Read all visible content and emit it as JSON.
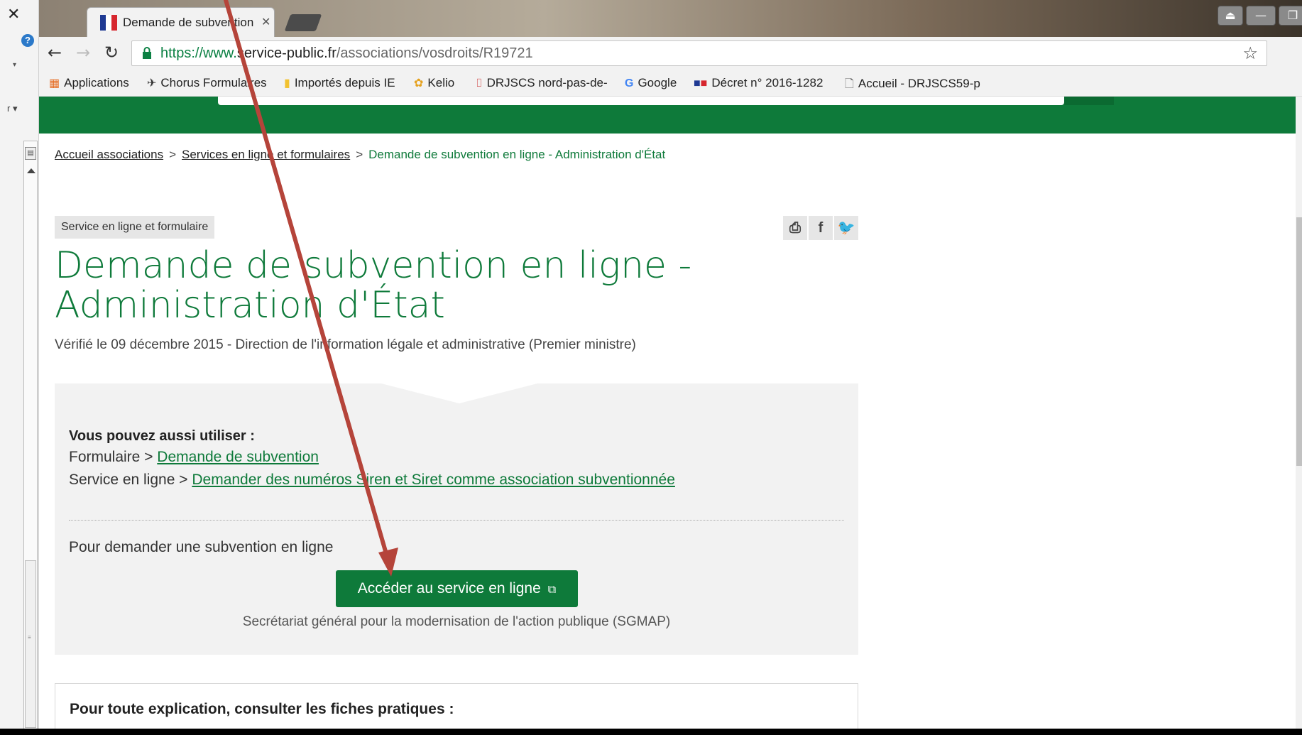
{
  "browser": {
    "tab_title": "Demande de subvention",
    "url_scheme": "https://www.",
    "url_domain": "service-public.fr",
    "url_path": "/associations/vosdroits/R19721"
  },
  "bookmarks": [
    {
      "label": "Applications",
      "icon": "apps-grid-icon"
    },
    {
      "label": "Chorus Formulaires",
      "icon": "bird-icon"
    },
    {
      "label": "Importés depuis IE",
      "icon": "folder-icon"
    },
    {
      "label": "Kelio",
      "icon": "kelio-icon"
    },
    {
      "label": "DRJSCS nord-pas-de-",
      "icon": "drjscs-icon"
    },
    {
      "label": "Google",
      "icon": "google-icon"
    },
    {
      "label": "Décret n° 2016-1282",
      "icon": "flag-icon"
    },
    {
      "label": "Accueil - DRJSCS59-p",
      "icon": "page-icon"
    }
  ],
  "breadcrumb": {
    "home": "Accueil associations",
    "sep": ">",
    "level2": "Services en ligne et formulaires",
    "current": "Demande de subvention en ligne - Administration d'État"
  },
  "tag": "Service en ligne et formulaire",
  "title": "Demande de subvention en ligne - Administration d'État",
  "verified": "Vérifié le 09 décembre 2015 - Direction de l'information légale et administrative (Premier ministre)",
  "aussi": {
    "heading": "Vous pouvez aussi utiliser :",
    "line1_prefix": "Formulaire > ",
    "line1_link": "Demande de subvention",
    "line2_prefix": "Service en ligne > ",
    "line2_link": "Demander des numéros Siren et Siret comme association subventionnée"
  },
  "service": {
    "intro": "Pour demander une subvention en ligne",
    "button": "Accéder au service en ligne",
    "org": "Secrétariat général pour la modernisation de l'action publique (SGMAP)"
  },
  "fiches": "Pour toute explication, consulter les fiches pratiques :",
  "colors": {
    "brand_green": "#0e7a3a",
    "arrow_red": "#b5443a"
  }
}
